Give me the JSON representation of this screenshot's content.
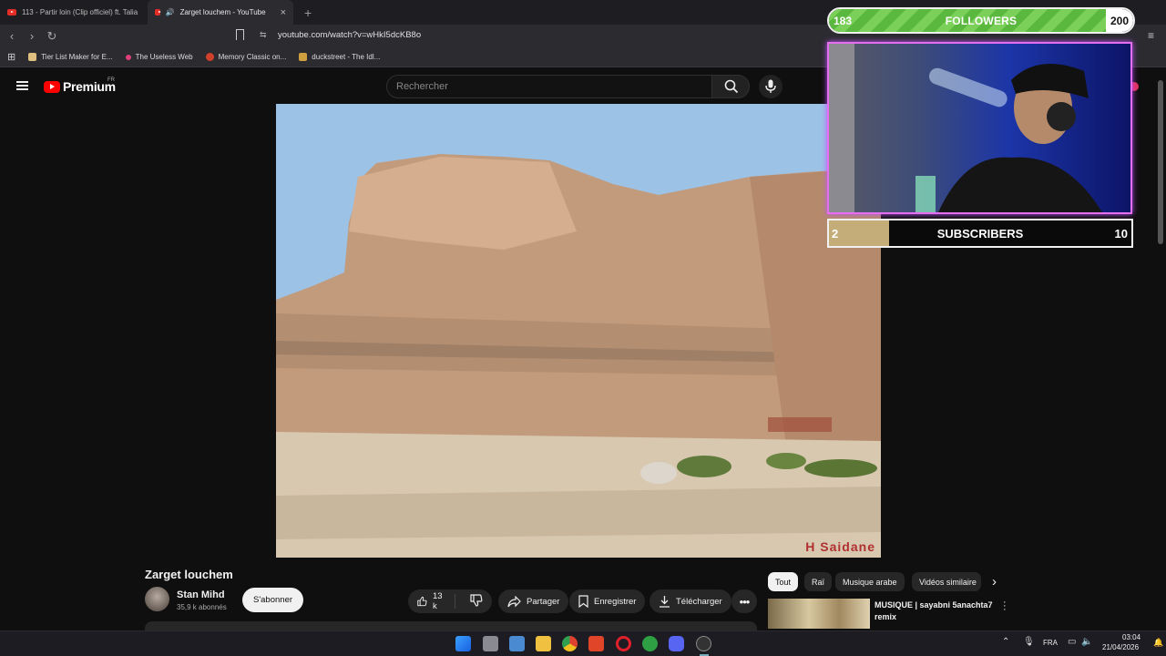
{
  "browser": {
    "tabs": [
      {
        "label": "113 - Partir loin (Clip officiel) ft. Talia"
      },
      {
        "label": "Zarget louchem - YouTube",
        "active": true
      }
    ],
    "url": "youtube.com/watch?v=wHkI5dcKB8o",
    "bookmarks": [
      {
        "label": "Tier List Maker for E...",
        "color": "#e0c080"
      },
      {
        "label": "The Useless Web",
        "color": "#e0407a"
      },
      {
        "label": "Memory Classic on...",
        "color": "#d0402a"
      },
      {
        "label": "duckstreet - The Idl...",
        "color": "#d0a040"
      }
    ]
  },
  "youtube": {
    "logo_text": "Premium",
    "logo_region": "FR",
    "search_placeholder": "Rechercher"
  },
  "video": {
    "watermark": "H Saidane",
    "title": "Zarget louchem",
    "channel": "Stan Mihd",
    "subscribers": "35,9 k abonnés",
    "subscribe_label": "S'abonner",
    "likes": "13 k",
    "share_label": "Partager",
    "save_label": "Enregistrer",
    "download_label": "Télécharger"
  },
  "chips": [
    "Tout",
    "Raï",
    "Musique arabe",
    "Vidéos similaire"
  ],
  "recommendation": {
    "title": "MUSIQUE | sayabni 5anachta7 remix"
  },
  "overlay": {
    "followers_label": "FOLLOWERS",
    "followers_current": "183",
    "followers_goal": "200",
    "followers_progress": 0.915,
    "subscribers_label": "SUBSCRIBERS",
    "subscribers_current": "2",
    "subscribers_goal": "10",
    "subscribers_progress": 0.2
  },
  "taskbar": {
    "language": "FRA",
    "time": "03:04",
    "date": "21/04/2026"
  }
}
